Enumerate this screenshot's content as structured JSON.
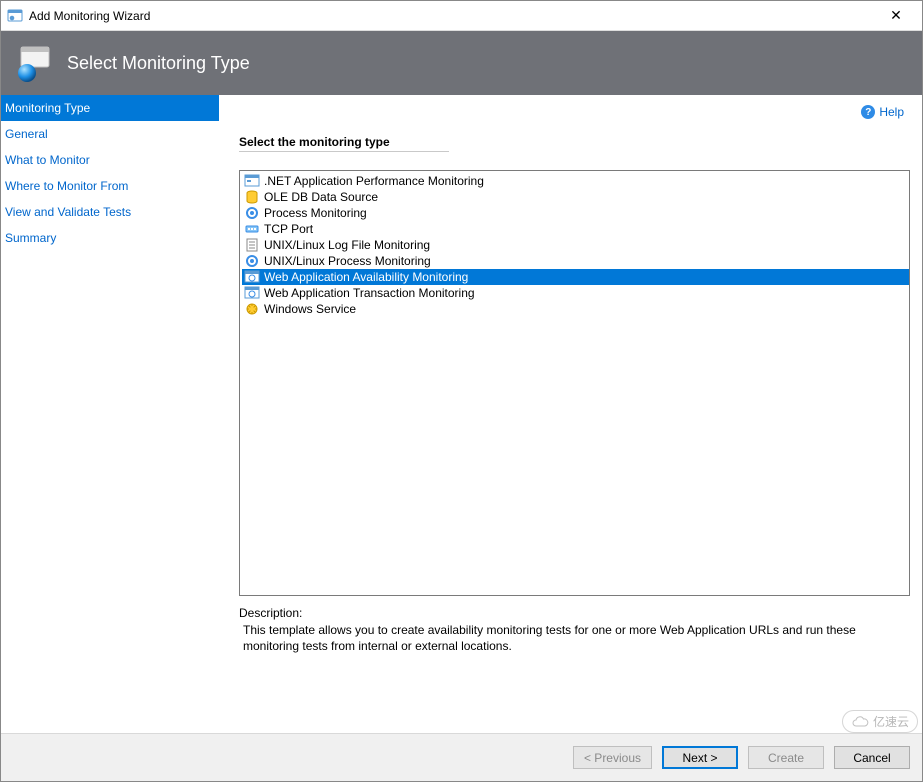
{
  "window": {
    "title": "Add Monitoring Wizard",
    "close": "✕"
  },
  "banner": {
    "title": "Select Monitoring Type"
  },
  "sidebar": {
    "items": [
      {
        "label": "Monitoring Type",
        "active": true
      },
      {
        "label": "General",
        "active": false
      },
      {
        "label": "What to Monitor",
        "active": false
      },
      {
        "label": "Where to Monitor From",
        "active": false
      },
      {
        "label": "View and Validate Tests",
        "active": false
      },
      {
        "label": "Summary",
        "active": false
      }
    ]
  },
  "help": {
    "label": "Help"
  },
  "main": {
    "section_label": "Select the monitoring type",
    "types": [
      {
        "label": ".NET Application Performance Monitoring",
        "icon": "app-icon",
        "selected": false
      },
      {
        "label": "OLE DB Data Source",
        "icon": "db-icon",
        "selected": false
      },
      {
        "label": "Process Monitoring",
        "icon": "process-icon",
        "selected": false
      },
      {
        "label": "TCP Port",
        "icon": "port-icon",
        "selected": false
      },
      {
        "label": "UNIX/Linux Log File Monitoring",
        "icon": "log-icon",
        "selected": false
      },
      {
        "label": "UNIX/Linux Process Monitoring",
        "icon": "process-icon",
        "selected": false
      },
      {
        "label": "Web Application Availability Monitoring",
        "icon": "web-icon",
        "selected": true
      },
      {
        "label": "Web Application Transaction Monitoring",
        "icon": "web-icon",
        "selected": false
      },
      {
        "label": "Windows Service",
        "icon": "service-icon",
        "selected": false
      }
    ],
    "description_label": "Description:",
    "description_text": "This template allows you to create availability monitoring tests for one or more Web Application URLs and run these monitoring tests from internal or external locations."
  },
  "footer": {
    "previous": "< Previous",
    "next": "Next >",
    "create": "Create",
    "cancel": "Cancel"
  },
  "watermark": {
    "text": "亿速云"
  }
}
